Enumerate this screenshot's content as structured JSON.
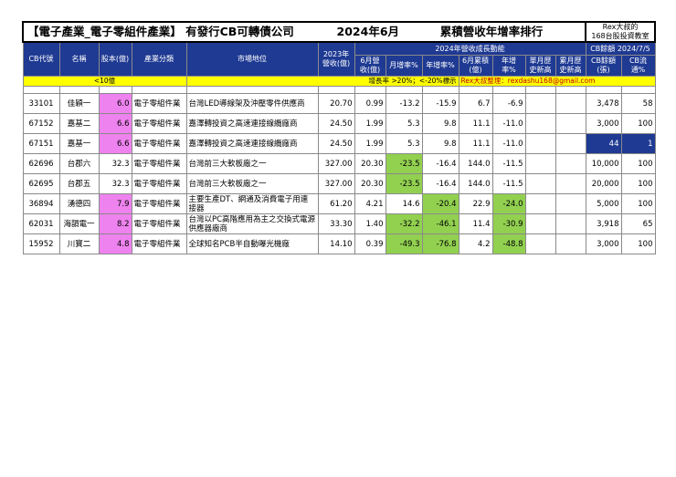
{
  "title": {
    "main": "【電子產業_電子零組件產業】 有發行CB可轉債公司",
    "date": "2024年6月",
    "ranking": "累積營收年增率排行",
    "badge_line1": "Rex大叔的",
    "badge_line2": "168台股投資教室"
  },
  "headers": {
    "cb_code": "CB代號",
    "name": "名稱",
    "capital": "股本(億)",
    "industry": "產業分類",
    "market_position": "市場地位",
    "rev_2023": "2023年營收(億)",
    "growth_group": "2024年營收成長動能",
    "jun_rev": "6月營收(億)",
    "mom": "月增率%",
    "yoy": "年增率%",
    "cum_rev": "6月累積(億)",
    "cum_yoy": "年增率%",
    "month_high": "單月歷史新高",
    "cum_high": "累月歷史新高",
    "cb_balance_group": "CB餘額 2024/7/5",
    "cb_amount": "CB餘額(張)",
    "cb_ratio": "CB流通%"
  },
  "legend": {
    "capital_note": "<10億",
    "growth_note": "增長率 >20%；<-20%標示",
    "credit": "Rex大叔整理：rexdashu168@gmail.com"
  },
  "rows": [
    {
      "code": "33101",
      "name": "佳穎一",
      "capital": "6.0",
      "industry": "電子零組件業",
      "position": "台灣LED導線架及沖壓零件供應商",
      "rev2023": "20.70",
      "jun": "0.99",
      "mom": "-13.2",
      "yoy": "-15.9",
      "cum": "6.7",
      "cumyoy": "-6.9",
      "mh": "",
      "ch": "",
      "cb": "3,478",
      "ratio": "58"
    },
    {
      "code": "67152",
      "name": "嘉基二",
      "capital": "6.6",
      "industry": "電子零組件業",
      "position": "嘉澤轉投資之高速連接線纜廠商",
      "rev2023": "24.50",
      "jun": "1.99",
      "mom": "5.3",
      "yoy": "9.8",
      "cum": "11.1",
      "cumyoy": "-11.0",
      "mh": "",
      "ch": "",
      "cb": "3,000",
      "ratio": "100"
    },
    {
      "code": "67151",
      "name": "嘉基一",
      "capital": "6.6",
      "industry": "電子零組件業",
      "position": "嘉澤轉投資之高速連接線纜廠商",
      "rev2023": "24.50",
      "jun": "1.99",
      "mom": "5.3",
      "yoy": "9.8",
      "cum": "11.1",
      "cumyoy": "-11.0",
      "mh": "",
      "ch": "",
      "cb": "44",
      "ratio": "1"
    },
    {
      "code": "62696",
      "name": "台郡六",
      "capital": "32.3",
      "industry": "電子零組件業",
      "position": "台灣前三大軟板廠之一",
      "rev2023": "327.00",
      "jun": "20.30",
      "mom": "-23.5",
      "yoy": "-16.4",
      "cum": "144.0",
      "cumyoy": "-11.5",
      "mh": "",
      "ch": "",
      "cb": "10,000",
      "ratio": "100"
    },
    {
      "code": "62695",
      "name": "台郡五",
      "capital": "32.3",
      "industry": "電子零組件業",
      "position": "台灣前三大軟板廠之一",
      "rev2023": "327.00",
      "jun": "20.30",
      "mom": "-23.5",
      "yoy": "-16.4",
      "cum": "144.0",
      "cumyoy": "-11.5",
      "mh": "",
      "ch": "",
      "cb": "20,000",
      "ratio": "100"
    },
    {
      "code": "36894",
      "name": "湧德四",
      "capital": "7.9",
      "industry": "電子零組件業",
      "position": "主要生產DT、網通及消費電子用連接器",
      "rev2023": "61.20",
      "jun": "4.21",
      "mom": "14.6",
      "yoy": "-20.4",
      "cum": "22.9",
      "cumyoy": "-24.0",
      "mh": "",
      "ch": "",
      "cb": "5,000",
      "ratio": "100"
    },
    {
      "code": "62031",
      "name": "海韻電一",
      "capital": "8.2",
      "industry": "電子零組件業",
      "position": "台灣以PC高階應用為主之交換式電源供應器廠商",
      "rev2023": "33.30",
      "jun": "1.40",
      "mom": "-32.2",
      "yoy": "-46.1",
      "cum": "11.4",
      "cumyoy": "-30.9",
      "mh": "",
      "ch": "",
      "cb": "3,918",
      "ratio": "65"
    },
    {
      "code": "15952",
      "name": "川寶二",
      "capital": "4.8",
      "industry": "電子零組件業",
      "position": "全球知名PCB半自動曝光機廠",
      "rev2023": "14.10",
      "jun": "0.39",
      "mom": "-49.3",
      "yoy": "-76.8",
      "cum": "4.2",
      "cumyoy": "-48.8",
      "mh": "",
      "ch": "",
      "cb": "3,000",
      "ratio": "100"
    }
  ],
  "highlights": {
    "pink_capital": [
      0,
      1,
      2,
      5,
      6,
      7
    ],
    "green": {
      "mom": [
        3,
        4,
        6,
        7
      ],
      "yoy": [
        5,
        6,
        7
      ],
      "cumyoy": [
        5,
        6,
        7
      ]
    },
    "blue_cb_row": 2,
    "colors": {
      "header": "#1f3a93",
      "pink": "#ee82ee",
      "green": "#92d050",
      "yellow": "#ffff00"
    }
  }
}
